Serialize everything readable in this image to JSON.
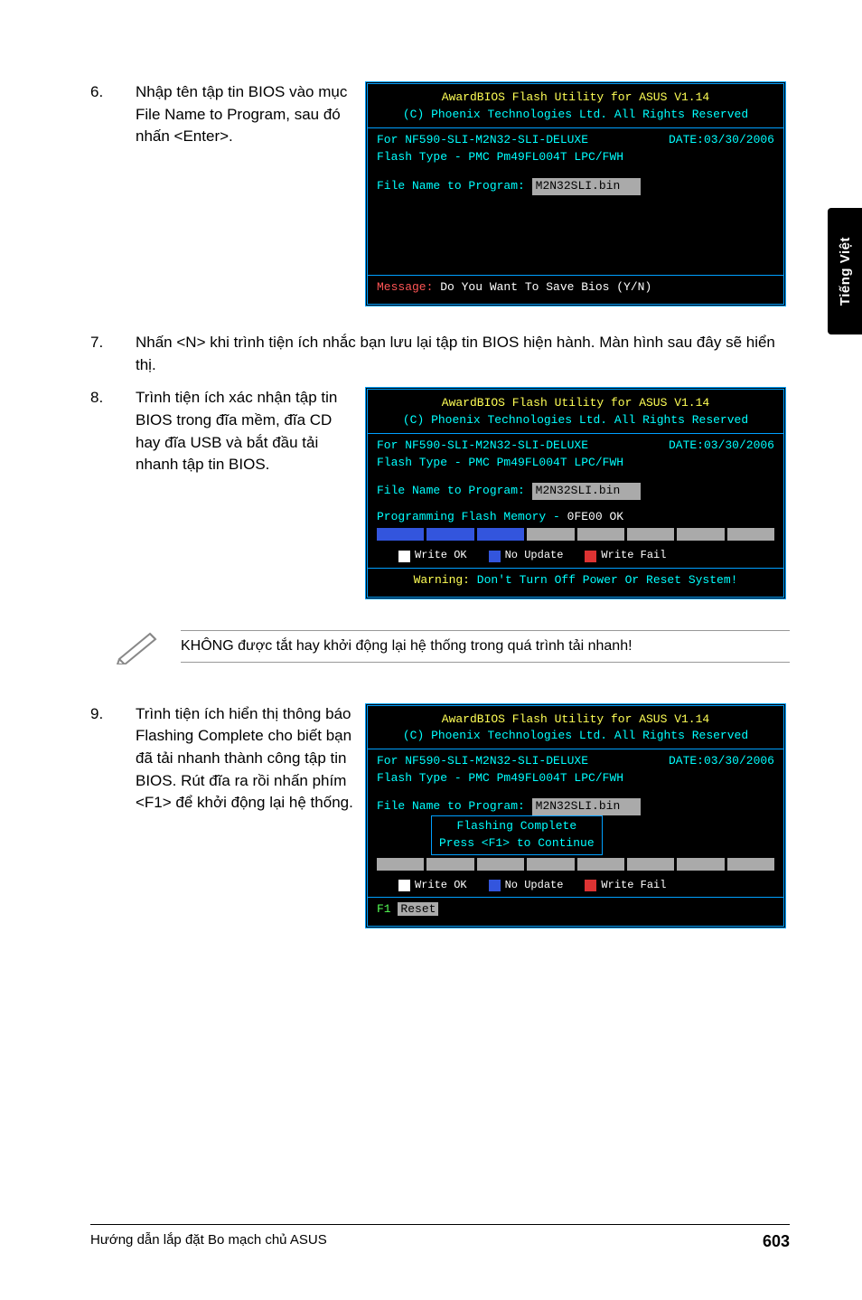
{
  "side_tab": "Tiếng Việt",
  "steps": {
    "s6": {
      "num": "6.",
      "text": "Nhập tên tập tin BIOS vào mục File Name to Program, sau đó nhấn <Enter>."
    },
    "s7": {
      "num": "7.",
      "text": "Nhấn <N> khi trình tiện ích nhắc bạn lưu lại tập tin BIOS hiện hành. Màn hình sau đây sẽ hiển thị."
    },
    "s8": {
      "num": "8.",
      "text": "Trình tiện ích xác nhận tập tin BIOS trong đĩa mềm, đĩa CD hay đĩa USB và bắt đầu tải nhanh tập tin BIOS."
    },
    "s9": {
      "num": "9.",
      "text": "Trình tiện ích hiển thị thông báo Flashing Complete cho biết bạn đã tải nhanh thành công tập tin BIOS. Rút đĩa ra rồi nhấn phím <F1> để khởi động lại hệ thống."
    }
  },
  "bios_common": {
    "title": "AwardBIOS Flash Utility for ASUS V1.14",
    "copyright": "(C) Phoenix Technologies Ltd. All Rights Reserved",
    "board": "For NF590-SLI-M2N32-SLI-DELUXE",
    "date": "DATE:03/30/2006",
    "flash_type": "Flash Type - PMC Pm49FL004T LPC/FWH",
    "file_label": "File Name to Program:",
    "file_value": "M2N32SLI.bin"
  },
  "bios1": {
    "msg_label": "Message:",
    "msg_text": " Do You Want To Save Bios (Y/N)"
  },
  "bios2": {
    "prog_label": "Programming Flash Memory - ",
    "prog_addr": "0FE00 OK",
    "legend": {
      "ok": "Write OK",
      "noup": "No Update",
      "fail": "Write Fail"
    },
    "warn_label": "Warning:",
    "warn_text": " Don't Turn Off Power Or Reset System!"
  },
  "bios3": {
    "flash_complete": "Flashing Complete",
    "press_f1": "Press <F1> to Continue",
    "legend": {
      "ok": "Write OK",
      "noup": "No Update",
      "fail": "Write Fail"
    },
    "f1_label": "F1",
    "reset": "Reset"
  },
  "note": "KHÔNG được tắt hay khởi động lại hệ thống trong quá trình tải nhanh!",
  "footer": {
    "left": "Hướng dẫn lắp đặt Bo mạch chủ ASUS",
    "right": "603"
  }
}
